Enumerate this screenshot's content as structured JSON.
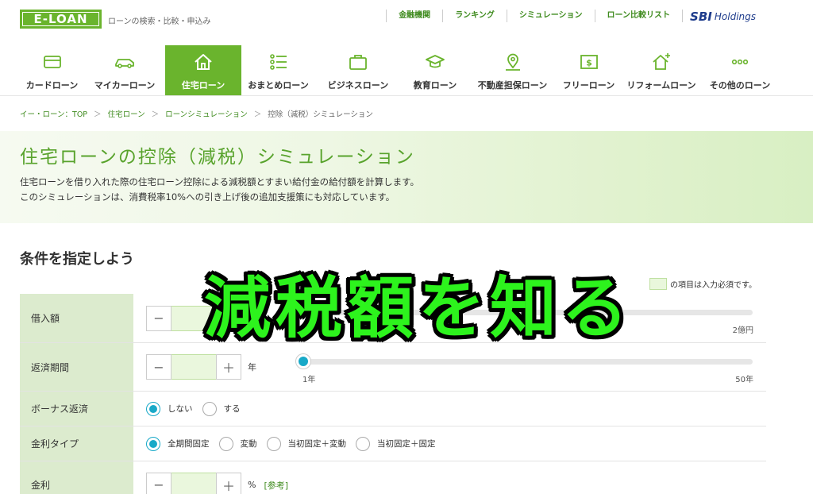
{
  "header": {
    "logo": "E-LOAN",
    "tagline": "ローンの検索・比較・申込み",
    "links": [
      "金融機関",
      "ランキング",
      "シミュレーション",
      "ローン比較リスト"
    ],
    "partner_mark": "SBI",
    "partner_text": "Holdings"
  },
  "nav": {
    "items": [
      {
        "label": "カードローン",
        "icon": "card-icon"
      },
      {
        "label": "マイカーローン",
        "icon": "car-icon"
      },
      {
        "label": "住宅ローン",
        "icon": "house-icon",
        "active": true
      },
      {
        "label": "おまとめローン",
        "icon": "list-icon"
      },
      {
        "label": "ビジネスローン",
        "icon": "briefcase-icon"
      },
      {
        "label": "教育ローン",
        "icon": "graduation-cap-icon"
      },
      {
        "label": "不動産担保ローン",
        "icon": "map-pin-icon"
      },
      {
        "label": "フリーローン",
        "icon": "yen-note-icon"
      },
      {
        "label": "リフォームローン",
        "icon": "house-plus-icon"
      },
      {
        "label": "その他のローン",
        "icon": "more-icon"
      }
    ]
  },
  "breadcrumb": {
    "items": [
      "イー・ローン：TOP",
      "住宅ローン",
      "ローンシミュレーション"
    ],
    "current": "控除（減税）シミュレーション",
    "sep": "＞"
  },
  "hero": {
    "title": "住宅ローンの控除（減税）シミュレーション",
    "desc1": "住宅ローンを借り入れた際の住宅ローン控除による減税額とすまい給付金の給付額を計算します。",
    "desc2": "このシミュレーションは、消費税率10%への引き上げ後の追加支援策にも対応しています。"
  },
  "section": {
    "title": "条件を指定しよう",
    "required_note": "の項目は入力必須です。"
  },
  "form": {
    "loan_amount": {
      "label": "借入額",
      "max_label": "2億円",
      "minus": "−",
      "plus": "＋"
    },
    "term": {
      "label": "返済期間",
      "unit": "年",
      "min_label": "1年",
      "max_label": "50年",
      "minus": "−",
      "plus": "＋"
    },
    "bonus": {
      "label": "ボーナス返済",
      "options": [
        "しない",
        "する"
      ],
      "selected": 0
    },
    "rate_type": {
      "label": "金利タイプ",
      "options": [
        "全期間固定",
        "変動",
        "当初固定＋変動",
        "当初固定＋固定"
      ],
      "selected": 0
    },
    "rate": {
      "label": "金利",
      "unit": "%",
      "ref": "[参考]",
      "minus": "−",
      "plus": "＋"
    }
  },
  "overlay": {
    "caption": "減税額を知る"
  },
  "colors": {
    "brand_green": "#6ab42d",
    "link_green": "#3f8b1e",
    "radio_blue": "#18a9c8",
    "caption_green": "#2df31d"
  }
}
